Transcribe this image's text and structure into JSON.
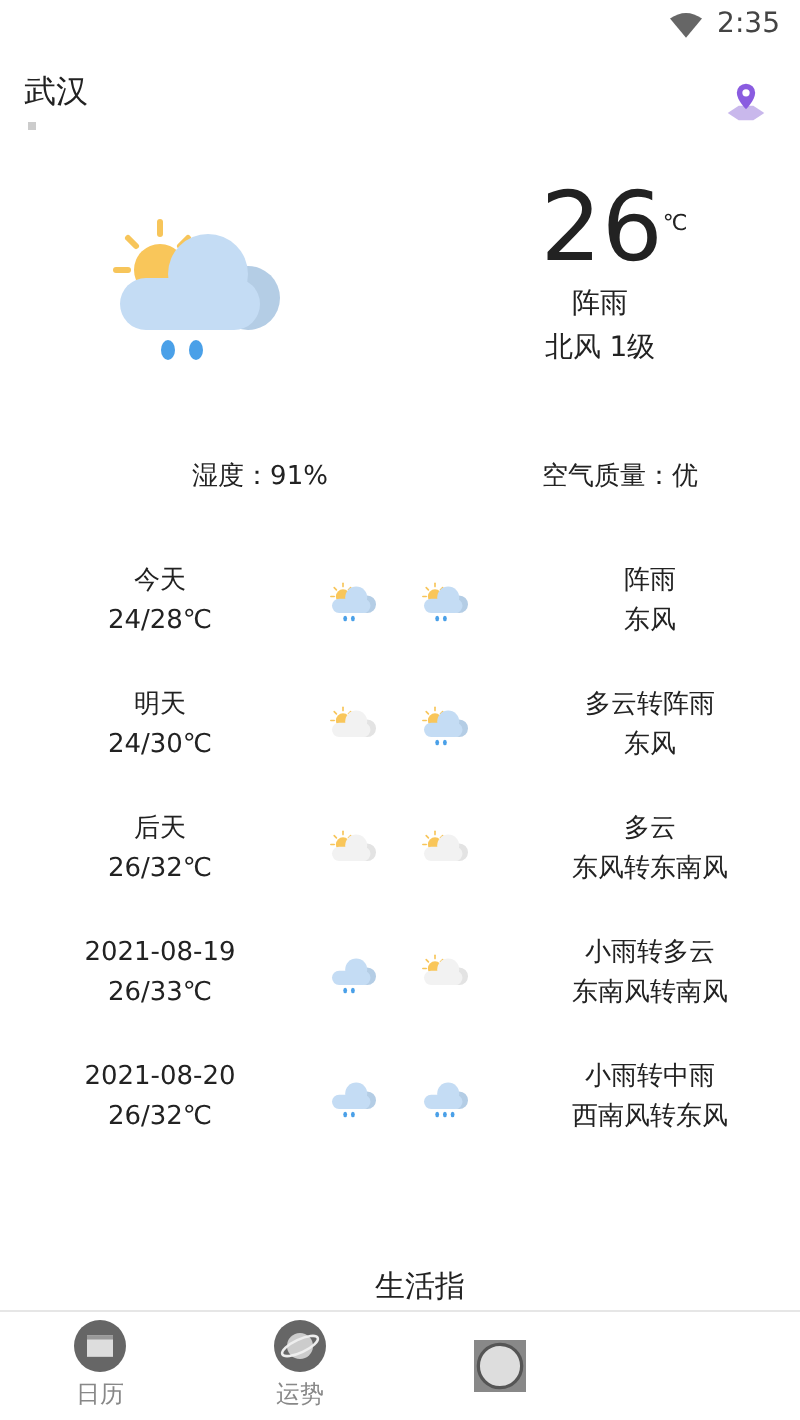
{
  "status_bar": {
    "time": "2:35"
  },
  "header": {
    "city": "武汉"
  },
  "current": {
    "icon": {
      "kind": "shower"
    },
    "temperature": "26",
    "unit": "℃",
    "condition": "阵雨",
    "wind": "北风 1级",
    "humidity": "湿度：91%",
    "air_quality": "空气质量：优"
  },
  "forecast": [
    {
      "day": "今天",
      "temps": "24/28℃",
      "icons": [
        {
          "kind": "shower"
        },
        {
          "kind": "shower"
        }
      ],
      "condition": "阵雨",
      "wind": "东风"
    },
    {
      "day": "明天",
      "temps": "24/30℃",
      "icons": [
        {
          "kind": "cloudy"
        },
        {
          "kind": "shower"
        }
      ],
      "condition": "多云转阵雨",
      "wind": "东风"
    },
    {
      "day": "后天",
      "temps": "26/32℃",
      "icons": [
        {
          "kind": "cloudy"
        },
        {
          "kind": "cloudy"
        }
      ],
      "condition": "多云",
      "wind": "东风转东南风"
    },
    {
      "day": "2021-08-19",
      "temps": "26/33℃",
      "icons": [
        {
          "kind": "rain"
        },
        {
          "kind": "cloudy"
        }
      ],
      "condition": "小雨转多云",
      "wind": "东南风转南风"
    },
    {
      "day": "2021-08-20",
      "temps": "26/32℃",
      "icons": [
        {
          "kind": "rain"
        },
        {
          "kind": "heavy"
        }
      ],
      "condition": "小雨转中雨",
      "wind": "西南风转东风"
    }
  ],
  "section_title": "生活指",
  "nav": [
    {
      "kind": "calendar",
      "label": "日历"
    },
    {
      "kind": "planet",
      "label": "运势"
    },
    {
      "kind": "clock"
    }
  ]
}
